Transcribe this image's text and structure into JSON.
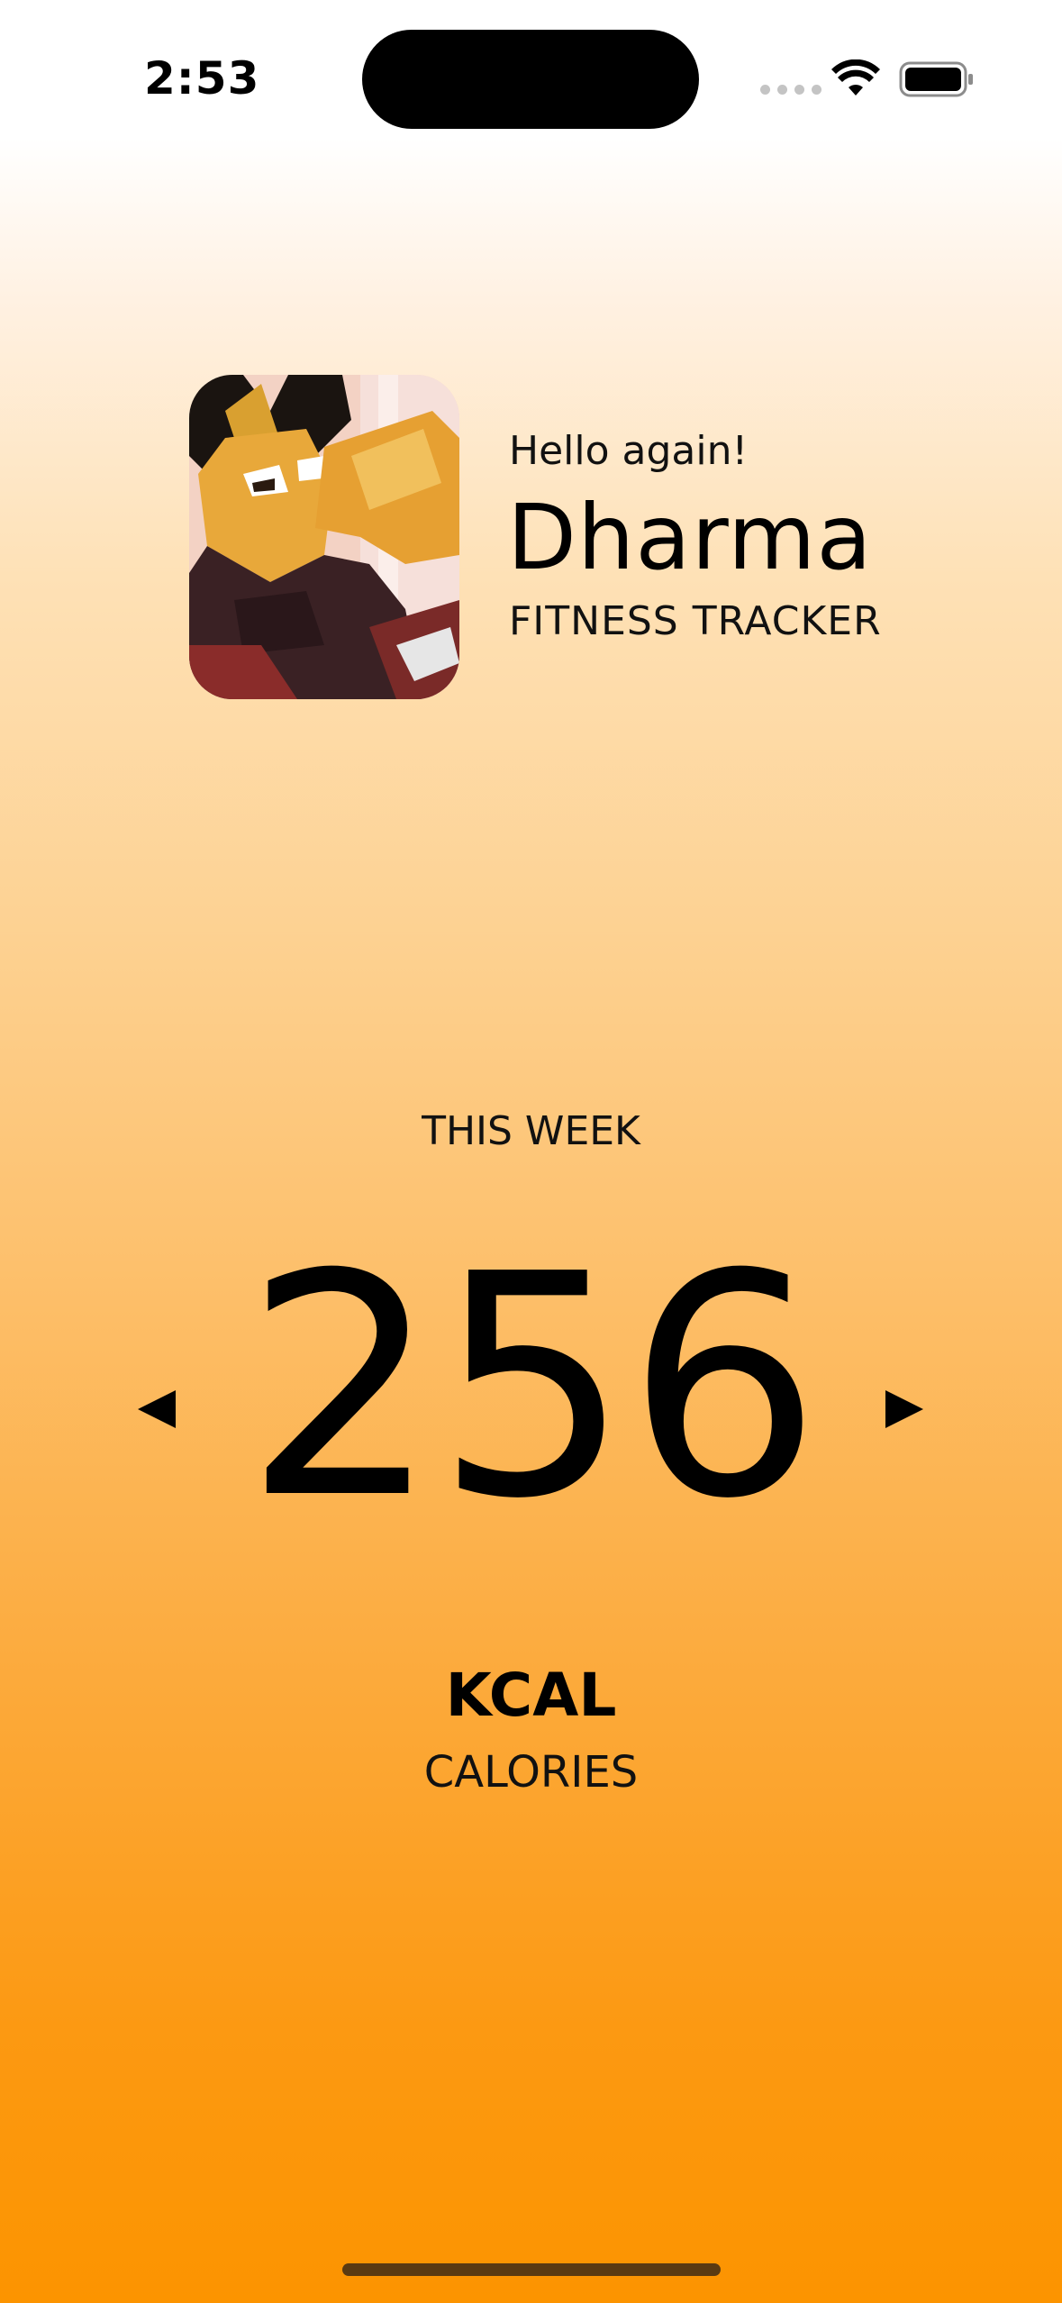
{
  "status_bar": {
    "time": "2:53",
    "icons": [
      "signal-dots-icon",
      "wifi-icon",
      "battery-icon"
    ]
  },
  "profile": {
    "avatar": "anime-character-avatar",
    "greeting": "Hello again!",
    "name": "Dharma",
    "subtitle": "FITNESS TRACKER"
  },
  "stats": {
    "period": "THIS WEEK",
    "value": "256",
    "unit": "KCAL",
    "metric": "CALORIES",
    "prev_icon": "chevron-left-icon",
    "next_icon": "chevron-right-icon"
  },
  "colors": {
    "gradient_top": "#ffffff",
    "gradient_bottom": "#fc9400",
    "text": "#000000"
  }
}
